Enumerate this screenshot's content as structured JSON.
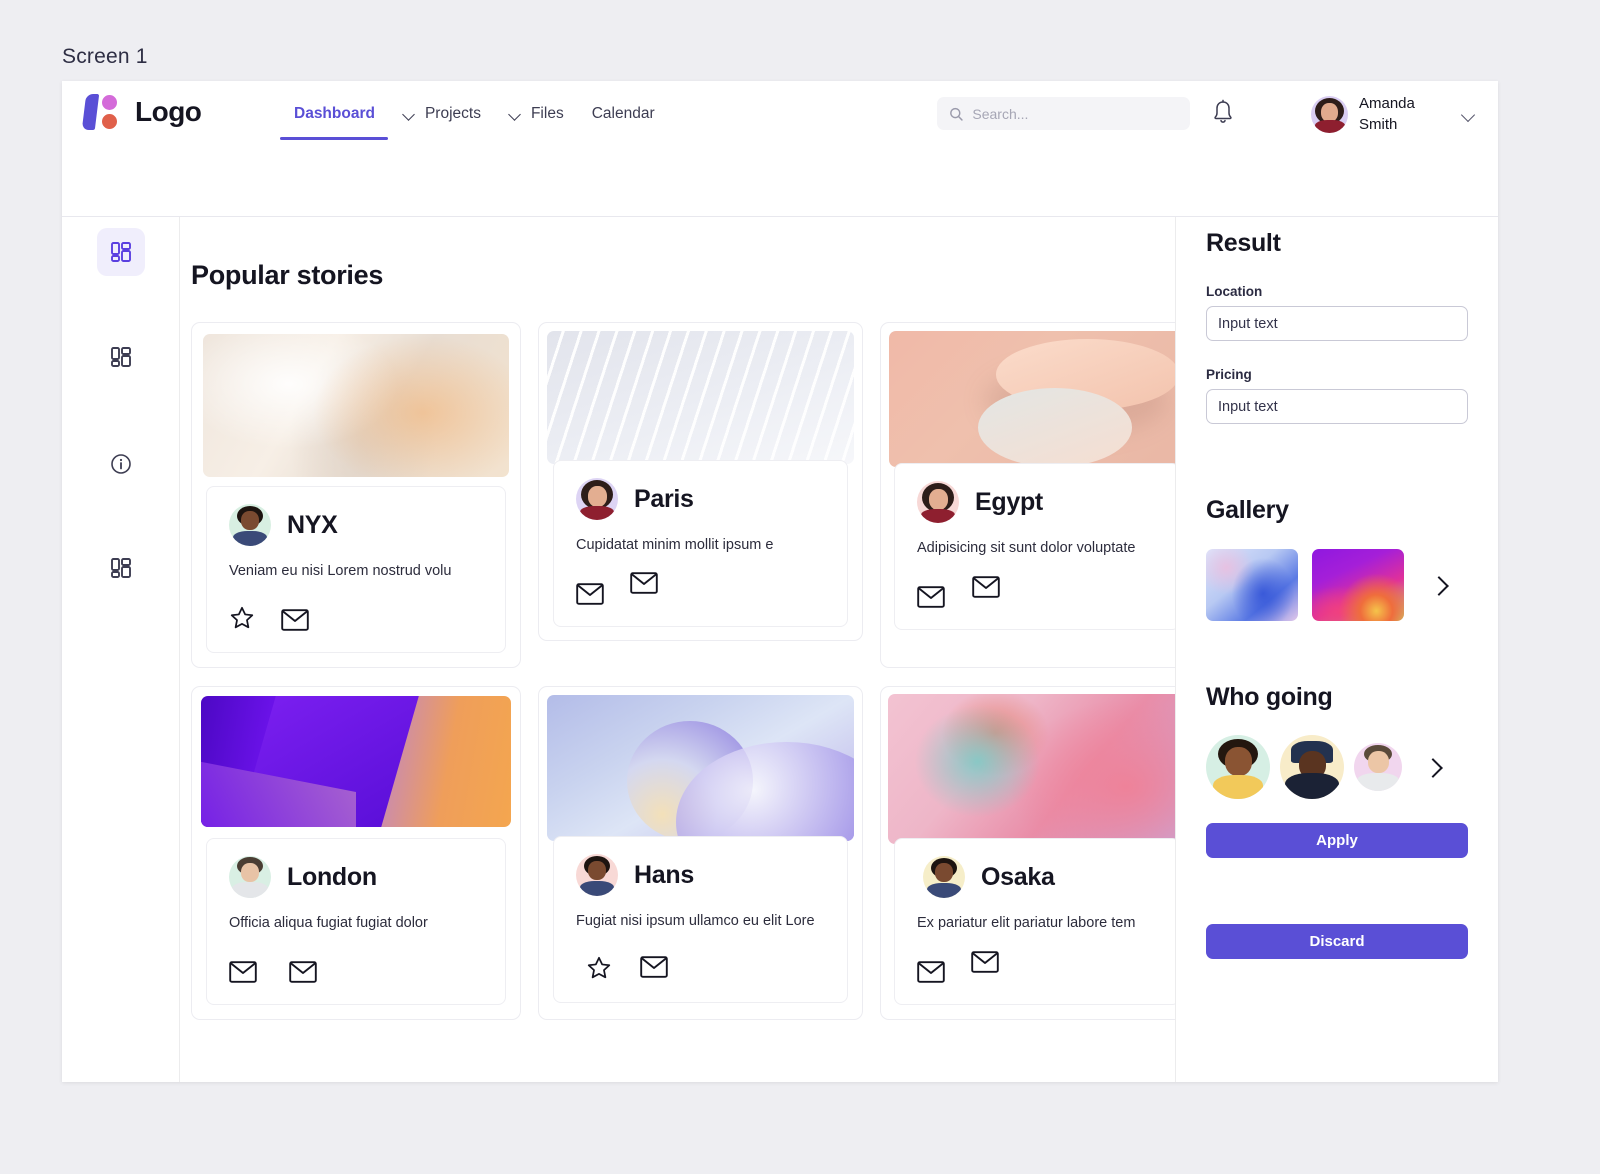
{
  "screen_label": "Screen 1",
  "header": {
    "logo_text": "Logo",
    "nav": [
      {
        "label": "Dashboard",
        "active": true,
        "has_chevron": false
      },
      {
        "label": "Projects",
        "active": false,
        "has_chevron": true
      },
      {
        "label": "Files",
        "active": false,
        "has_chevron": true
      },
      {
        "label": "Calendar",
        "active": false,
        "has_chevron": false
      }
    ],
    "search_placeholder": "Search...",
    "search_value": "",
    "notifications_icon": "bell-icon",
    "user_name": "Amanda Smith",
    "user_menu_icon": "chevron-down-icon"
  },
  "rail": [
    {
      "icon": "dashboard-grid-icon",
      "active": true
    },
    {
      "icon": "dashboard-grid-icon",
      "active": false
    },
    {
      "icon": "info-circle-icon",
      "active": false
    },
    {
      "icon": "dashboard-grid-icon",
      "active": false
    }
  ],
  "main": {
    "title": "Popular stories",
    "cards": [
      {
        "name": "NYX",
        "desc": "Veniam eu nisi Lorem nostrud volu",
        "actions": [
          "star-icon",
          "envelope-icon"
        ]
      },
      {
        "name": "Paris",
        "desc": "Cupidatat minim mollit ipsum e",
        "actions": [
          "envelope-icon",
          "envelope-icon"
        ]
      },
      {
        "name": "Egypt",
        "desc": "Adipisicing sit sunt dolor voluptate",
        "actions": [
          "envelope-icon",
          "envelope-icon"
        ]
      },
      {
        "name": "London",
        "desc": "Officia aliqua fugiat fugiat dolor",
        "actions": [
          "envelope-icon",
          "envelope-icon"
        ]
      },
      {
        "name": "Hans",
        "desc": "Fugiat nisi ipsum ullamco eu elit Lore",
        "actions": [
          "star-icon",
          "envelope-icon"
        ]
      },
      {
        "name": "Osaka",
        "desc": "Ex pariatur elit pariatur labore tem",
        "actions": [
          "envelope-icon",
          "envelope-icon"
        ]
      }
    ]
  },
  "right": {
    "result_title": "Result",
    "location_label": "Location",
    "location_placeholder": "Input text",
    "location_value": "",
    "pricing_label": "Pricing",
    "pricing_placeholder": "Input text",
    "pricing_value": "",
    "gallery_title": "Gallery",
    "gallery_next_icon": "chevron-right-icon",
    "going_title": "Who going",
    "going_next_icon": "chevron-right-icon",
    "apply_label": "Apply",
    "discard_label": "Discard"
  },
  "colors": {
    "accent": "#5a4fd6",
    "accent_soft": "#f0eefc",
    "page_bg": "#eeeef2",
    "text": "#151521"
  }
}
